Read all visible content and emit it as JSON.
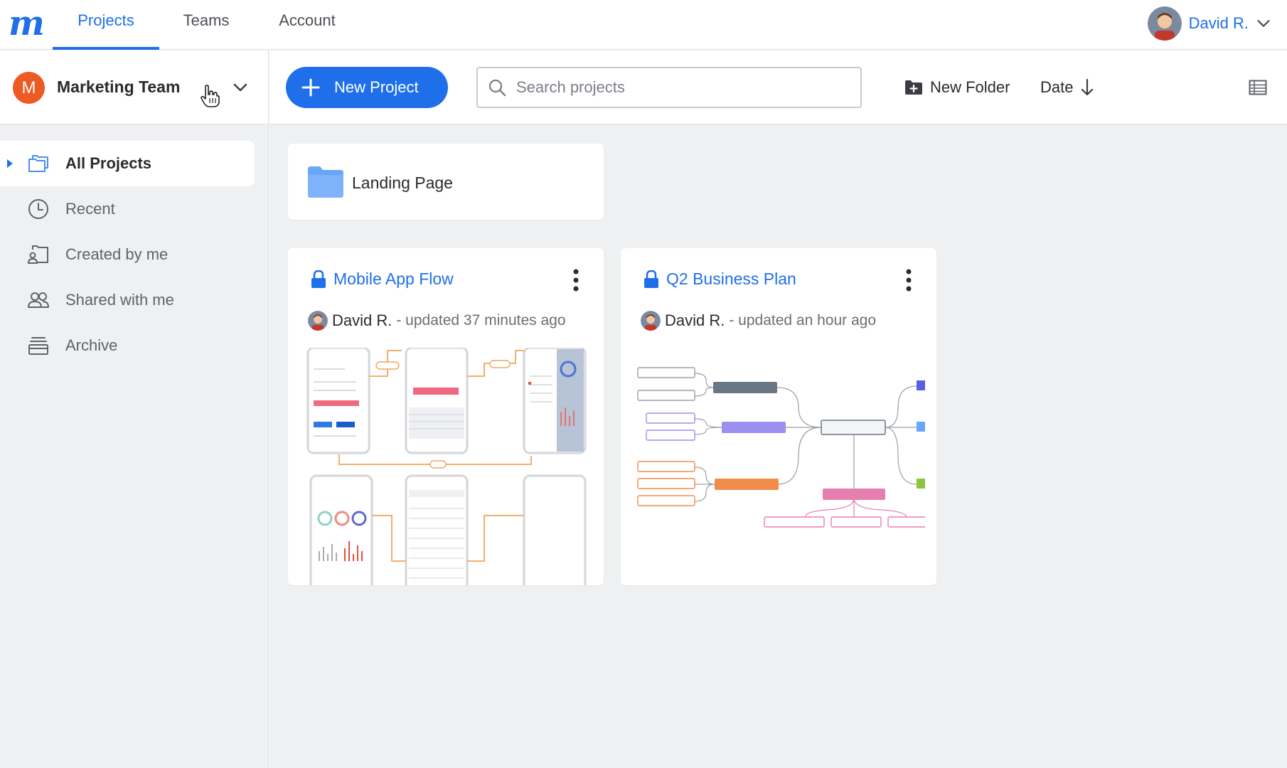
{
  "nav": {
    "logo": "m",
    "tabs": [
      {
        "label": "Projects"
      },
      {
        "label": "Teams"
      },
      {
        "label": "Account"
      }
    ],
    "user_name": "David R."
  },
  "team": {
    "initial": "M",
    "name": "Marketing Team"
  },
  "toolbar": {
    "new_project": "New Project",
    "search_placeholder": "Search projects",
    "new_folder": "New Folder",
    "sort": "Date"
  },
  "sidebar": {
    "items": [
      {
        "label": "All Projects"
      },
      {
        "label": "Recent"
      },
      {
        "label": "Created by me"
      },
      {
        "label": "Shared with me"
      },
      {
        "label": "Archive"
      }
    ]
  },
  "folders": [
    {
      "name": "Landing Page"
    }
  ],
  "projects": [
    {
      "title": "Mobile App Flow",
      "owner": "David R.",
      "updated": "- updated 37 minutes ago"
    },
    {
      "title": "Q2 Business Plan",
      "owner": "David R.",
      "updated": "- updated an hour ago"
    }
  ],
  "colors": {
    "accent": "#1f6feb",
    "team_avatar": "#ee5a24",
    "folder": "#6aa6f8"
  }
}
